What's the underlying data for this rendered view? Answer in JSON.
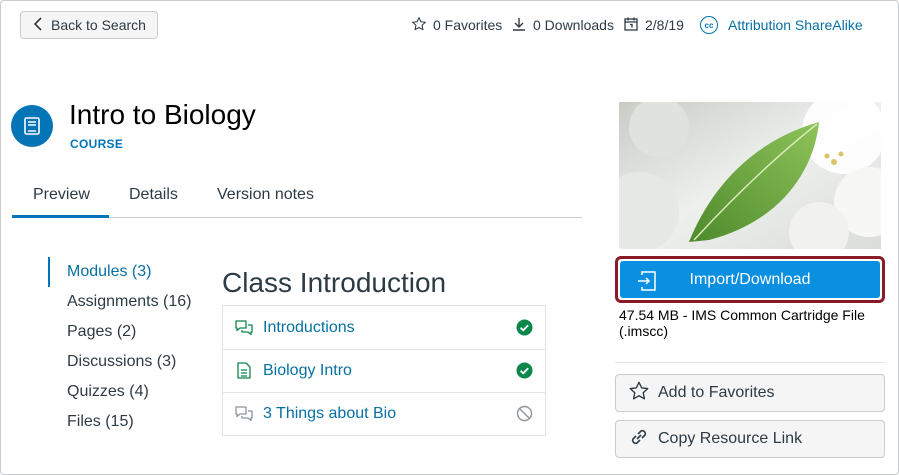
{
  "topbar": {
    "back_label": "Back to Search",
    "favorites": "0 Favorites",
    "downloads": "0 Downloads",
    "date": "2/8/19",
    "license_badge": "cc",
    "license": "Attribution ShareAlike"
  },
  "course": {
    "title": "Intro to Biology",
    "type": "COURSE"
  },
  "tabs": [
    {
      "label": "Preview",
      "active": true
    },
    {
      "label": "Details"
    },
    {
      "label": "Version notes"
    }
  ],
  "sidebar": {
    "items": [
      {
        "label": "Modules (3)",
        "active": true
      },
      {
        "label": "Assignments (16)"
      },
      {
        "label": "Pages (2)"
      },
      {
        "label": "Discussions (3)"
      },
      {
        "label": "Quizzes (4)"
      },
      {
        "label": "Files (15)"
      }
    ]
  },
  "module": {
    "title": "Class Introduction",
    "items": [
      {
        "label": "Introductions",
        "icon": "discussion-icon",
        "status": "complete"
      },
      {
        "label": "Biology Intro",
        "icon": "page-icon",
        "status": "complete"
      },
      {
        "label": "3 Things about Bio",
        "icon": "discussion-icon",
        "status": "unpublished"
      }
    ]
  },
  "resource": {
    "import_label": "Import/Download",
    "file_info": "47.54 MB - IMS Common Cartridge File (.imscc)",
    "favorite_label": "Add to Favorites",
    "copy_link_label": "Copy Resource Link"
  },
  "colors": {
    "accent": "#0374b5",
    "link": "#0770a3",
    "success": "#0b874b",
    "import_button": "#0b8fe0",
    "focus_outline": "#8b1a27"
  }
}
